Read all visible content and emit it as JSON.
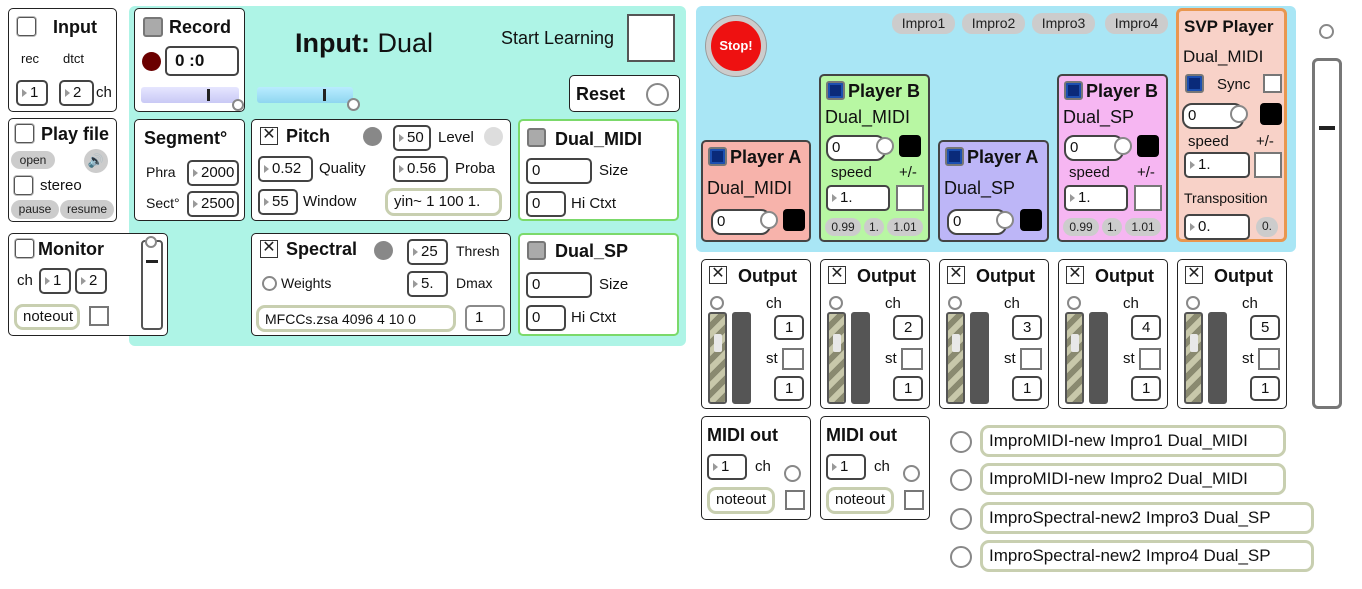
{
  "input": {
    "title": "Input",
    "rec": "rec",
    "dtct": "dtct",
    "ch1": "1",
    "ch2": "2",
    "ch": "ch"
  },
  "record": {
    "title": "Record",
    "time": "0 :0"
  },
  "input_mode": {
    "prefix": "Input:",
    "mode": "Dual"
  },
  "learning": {
    "start": "Start Learning",
    "reset": "Reset"
  },
  "playfile": {
    "title": "Play file",
    "open": "open",
    "stereo": "stereo",
    "pause": "pause",
    "resume": "resume"
  },
  "monitor": {
    "title": "Monitor",
    "ch": "ch",
    "ch1": "1",
    "ch2": "2",
    "noteout": "noteout"
  },
  "segment": {
    "title": "Segment°",
    "phra_label": "Phra",
    "phra": "2000",
    "sect_label": "Sect°",
    "sect": "2500"
  },
  "pitch": {
    "title": "Pitch",
    "level_val": "50",
    "level": "Level",
    "quality_val": "0.52",
    "quality": "Quality",
    "proba_val": "0.56",
    "proba": "Proba",
    "window_val": "55",
    "window": "Window",
    "yin": "yin~ 1 100 1."
  },
  "spectral": {
    "title": "Spectral",
    "thresh_val": "25",
    "thresh": "Thresh",
    "weights": "Weights",
    "dmax_val": "5.",
    "dmax": "Dmax",
    "mfcc": "MFCCs.zsa 4096 4 10 0",
    "mfcc_val": "1"
  },
  "dual_midi": {
    "title": "Dual_MIDI",
    "size_val": "0",
    "size": "Size",
    "hictxt_val": "0",
    "hictxt": "Hi Ctxt"
  },
  "dual_sp": {
    "title": "Dual_SP",
    "size_val": "0",
    "size": "Size",
    "hictxt_val": "0",
    "hictxt": "Hi Ctxt"
  },
  "stop": "Stop!",
  "impro_tabs": [
    "Impro1",
    "Impro2",
    "Impro3",
    "Impro4"
  ],
  "player_a1": {
    "title": "Player A",
    "name": "Dual_MIDI",
    "val": "0"
  },
  "player_b1": {
    "title": "Player B",
    "name": "Dual_MIDI",
    "val": "0",
    "speed": "speed",
    "pm": "+/-",
    "speed_val": "1.",
    "p1": "0.99",
    "p2": "1.",
    "p3": "1.01"
  },
  "player_a2": {
    "title": "Player A",
    "name": "Dual_SP",
    "val": "0"
  },
  "player_b2": {
    "title": "Player B",
    "name": "Dual_SP",
    "val": "0",
    "speed": "speed",
    "pm": "+/-",
    "speed_val": "1.",
    "p1": "0.99",
    "p2": "1.",
    "p3": "1.01"
  },
  "svp": {
    "title": "SVP Player",
    "name": "Dual_MIDI",
    "sync": "Sync",
    "val": "0",
    "speed": "speed",
    "pm": "+/-",
    "speed_val": "1.",
    "transposition": "Transposition",
    "trans_val": "0.",
    "trans_btn": "0."
  },
  "outputs": [
    {
      "title": "Output",
      "ch": "ch",
      "ch_val": "1",
      "st": "st",
      "out": "1"
    },
    {
      "title": "Output",
      "ch": "ch",
      "ch_val": "2",
      "st": "st",
      "out": "1"
    },
    {
      "title": "Output",
      "ch": "ch",
      "ch_val": "3",
      "st": "st",
      "out": "1"
    },
    {
      "title": "Output",
      "ch": "ch",
      "ch_val": "4",
      "st": "st",
      "out": "1"
    },
    {
      "title": "Output",
      "ch": "ch",
      "ch_val": "5",
      "st": "st",
      "out": "1"
    }
  ],
  "midiout": [
    {
      "title": "MIDI out",
      "ch_val": "1",
      "ch": "ch",
      "noteout": "noteout"
    },
    {
      "title": "MIDI out",
      "ch_val": "1",
      "ch": "ch",
      "noteout": "noteout"
    }
  ],
  "messages": [
    "ImproMIDI-new Impro1 Dual_MIDI",
    "ImproMIDI-new Impro2 Dual_MIDI",
    "ImproSpectral-new2 Impro3 Dual_SP",
    "ImproSpectral-new2 Impro4 Dual_SP"
  ],
  "colors": {
    "teal": "#aef4e6",
    "sky": "#a9e6f5",
    "pink": "#f7b3ab",
    "green": "#b8f7a3",
    "lavender": "#bdb6f7",
    "magenta": "#f6b6f2",
    "orange": "#e9974f",
    "stop_red": "#ee1111"
  }
}
